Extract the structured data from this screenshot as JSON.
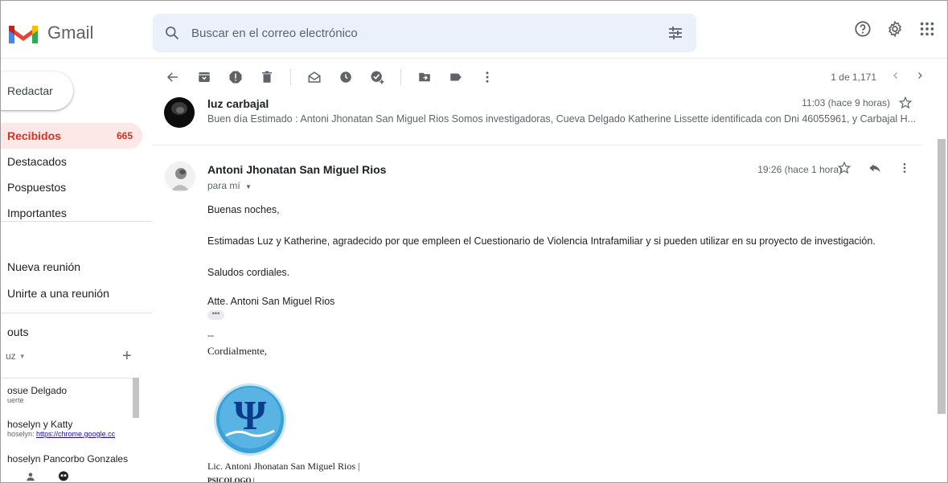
{
  "app": {
    "logo_text": "Gmail",
    "brand_colors": {
      "red": "#ea4335",
      "blue": "#4285f4",
      "green": "#34a853",
      "yellow": "#fbbc04"
    }
  },
  "search": {
    "placeholder": "Buscar en el correo electrónico"
  },
  "header_icons": [
    "help-icon",
    "settings-gear-icon",
    "apps-grid-icon"
  ],
  "sidebar": {
    "compose_label": "Redactar",
    "items": [
      {
        "label": "Recibidos",
        "count": "665",
        "active": true
      },
      {
        "label": "Destacados"
      },
      {
        "label": "Pospuestos"
      },
      {
        "label": "Importantes"
      }
    ],
    "meet": {
      "new_meeting": "Nueva reunión",
      "join_meeting": "Unirte a una reunión"
    },
    "hangouts": {
      "title": "outs",
      "user": "uz",
      "contacts": [
        {
          "name": "osue Delgado",
          "sub": "uerte"
        },
        {
          "name": "hoselyn y Katty",
          "sub_prefix": "hoselyn: ",
          "sub_link": "https://chrome.google.cc"
        },
        {
          "name": "hoselyn Pancorbo Gonzales"
        }
      ]
    }
  },
  "toolbar": {
    "icons": [
      "back-arrow-icon",
      "archive-icon",
      "report-spam-icon",
      "delete-icon",
      "mark-unread-icon",
      "snooze-icon",
      "add-task-icon",
      "move-to-icon",
      "label-icon",
      "more-vert-icon"
    ],
    "pager_text": "1 de 1,171"
  },
  "thread": {
    "collapsed": {
      "sender": "luz carbajal",
      "time": "11:03 (hace 9 horas)",
      "snippet": "Buen día Estimado : Antoni Jhonatan San Miguel Rios Somos investigadoras, Cueva Delgado Katherine Lissette identificada con Dni 46055961, y Carbajal H..."
    },
    "open": {
      "sender": "Antoni Jhonatan San Miguel Rios",
      "to": "para mí",
      "time": "19:26 (hace 1 hora)",
      "body": [
        "Buenas noches,",
        "Estimadas Luz y Katherine, agradecido por que empleen el Cuestionario de Violencia Intrafamiliar y si pueden utilizar en su proyecto de investigación.",
        "Saludos cordiales.",
        "Atte. Antoni San Miguel Rios"
      ],
      "ellipsis": "•••",
      "sig_dash": "--",
      "sig_greeting": "Cordialmente,",
      "sig_name": "Lic. Antoni Jhonatan San Miguel Rios  |",
      "sig_title": "PSICOLOGO  |",
      "logo_symbol": "Ψ"
    }
  }
}
